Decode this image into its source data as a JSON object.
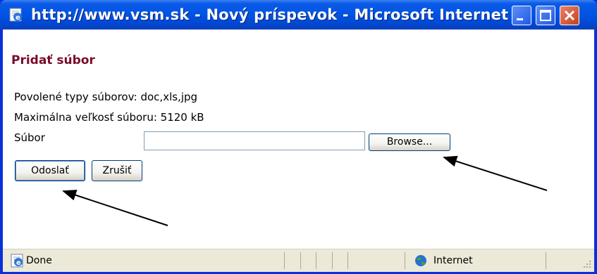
{
  "window": {
    "title": "http://www.vsm.sk - Nový príspevok - Microsoft Internet ...",
    "controls": {
      "minimize": "minimize",
      "maximize": "maximize",
      "close": "close"
    }
  },
  "content": {
    "heading": "Pridať súbor",
    "allowed_types": "Povolené typy súborov: doc,xls,jpg",
    "max_size": "Maximálna veľkosť súboru: 5120 kB",
    "file_label": "Súbor",
    "file_value": "",
    "browse_label": "Browse...",
    "submit_label": "Odoslať",
    "cancel_label": "Zrušiť"
  },
  "statusbar": {
    "status": "Done",
    "zone": "Internet"
  },
  "icons": {
    "title": "ie-page-icon",
    "status": "ie-page-icon",
    "zone": "globe-icon"
  },
  "colors": {
    "titlebar": "#0055e5",
    "heading": "#7a0a2a",
    "close_button": "#c7401b"
  }
}
